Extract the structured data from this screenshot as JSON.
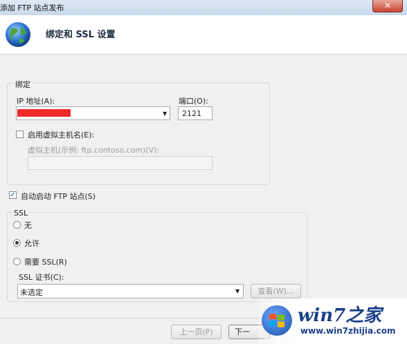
{
  "window": {
    "title": "添加 FTP 站点发布",
    "close_label": "✕"
  },
  "header": {
    "title": "绑定和 SSL 设置",
    "icon": "globe-icon"
  },
  "binding": {
    "group_label": "绑定",
    "ip_label": "IP 地址(A):",
    "ip_dropdown_arrow": "▼",
    "port_label": "端口(O):",
    "port_value": "2121",
    "virtual_host_checkbox_label": "启用虚拟主机名(E):",
    "virtual_host_checked": false,
    "virtual_host_field_label": "虚拟主机(示例: ftp.contoso.com)(V):",
    "virtual_host_value": ""
  },
  "autostart": {
    "label": "自动启动 FTP 站点(S)",
    "checked": true,
    "check_glyph": "✓"
  },
  "ssl": {
    "group_label": "SSL",
    "options": [
      {
        "label": "无",
        "selected": false
      },
      {
        "label": "允许",
        "selected": true
      },
      {
        "label": "需要 SSL(R)",
        "selected": false
      }
    ],
    "cert_label": "SSL 证书(C):",
    "cert_value": "未选定",
    "cert_dropdown_arrow": "▼",
    "view_button": "查看(W)..."
  },
  "footer": {
    "prev_button": "上一页(P)",
    "next_button": "下一"
  },
  "watermark": {
    "brand": "win7之家",
    "url": "www.win7zhijia.com",
    "logo_text": "Windows7"
  },
  "colors": {
    "accent": "#1b3f88",
    "redacted": "#ee2b2b"
  }
}
